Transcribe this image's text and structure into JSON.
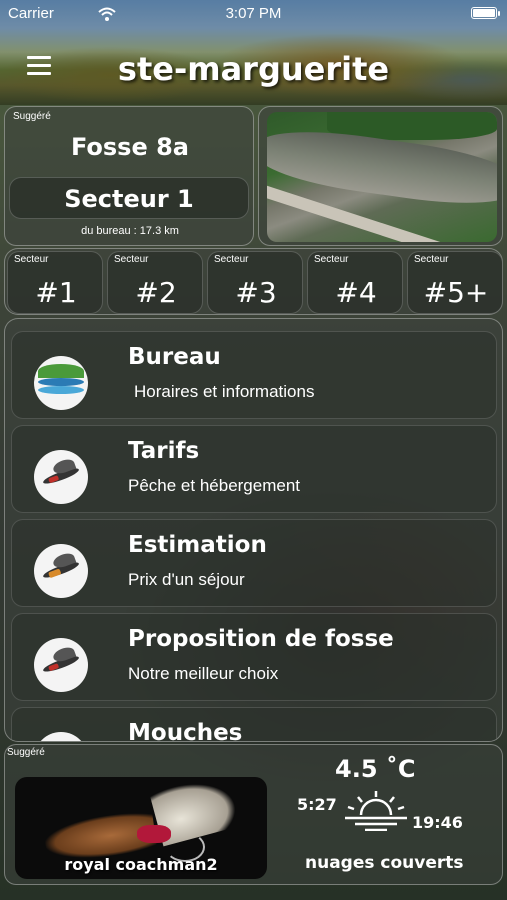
{
  "status_bar": {
    "carrier": "Carrier",
    "time": "3:07 PM",
    "battery_level": 1.0
  },
  "header": {
    "title": "ste-marguerite",
    "menu_icon": "hamburger-menu-icon"
  },
  "suggested_fosse": {
    "label": "Suggéré",
    "name": "Fosse 8a",
    "sector": "Secteur 1",
    "distance": "du bureau : 17.3 km"
  },
  "sectors": [
    {
      "label": "Secteur",
      "number": "#1"
    },
    {
      "label": "Secteur",
      "number": "#2"
    },
    {
      "label": "Secteur",
      "number": "#3"
    },
    {
      "label": "Secteur",
      "number": "#4"
    },
    {
      "label": "Secteur",
      "number": "#5+"
    }
  ],
  "menu_items": [
    {
      "title": "Bureau",
      "subtitle": "Horaires et informations",
      "icon": "office-logo-icon"
    },
    {
      "title": "Tarifs",
      "subtitle": "Pêche et hébergement",
      "icon": "fly-icon"
    },
    {
      "title": "Estimation",
      "subtitle": "Prix d'un séjour",
      "icon": "fly-icon"
    },
    {
      "title": "Proposition de fosse",
      "subtitle": "Notre meilleur choix",
      "icon": "fly-icon"
    },
    {
      "title": "Mouches",
      "subtitle": "",
      "icon": "fly-icon"
    }
  ],
  "suggested_fly": {
    "label": "Suggéré",
    "name": "royal coachman2"
  },
  "weather": {
    "temperature": "4.5 ˚C",
    "sunrise": "5:27",
    "sunset": "19:46",
    "description": "nuages couverts",
    "icon": "sunrise-icon"
  }
}
